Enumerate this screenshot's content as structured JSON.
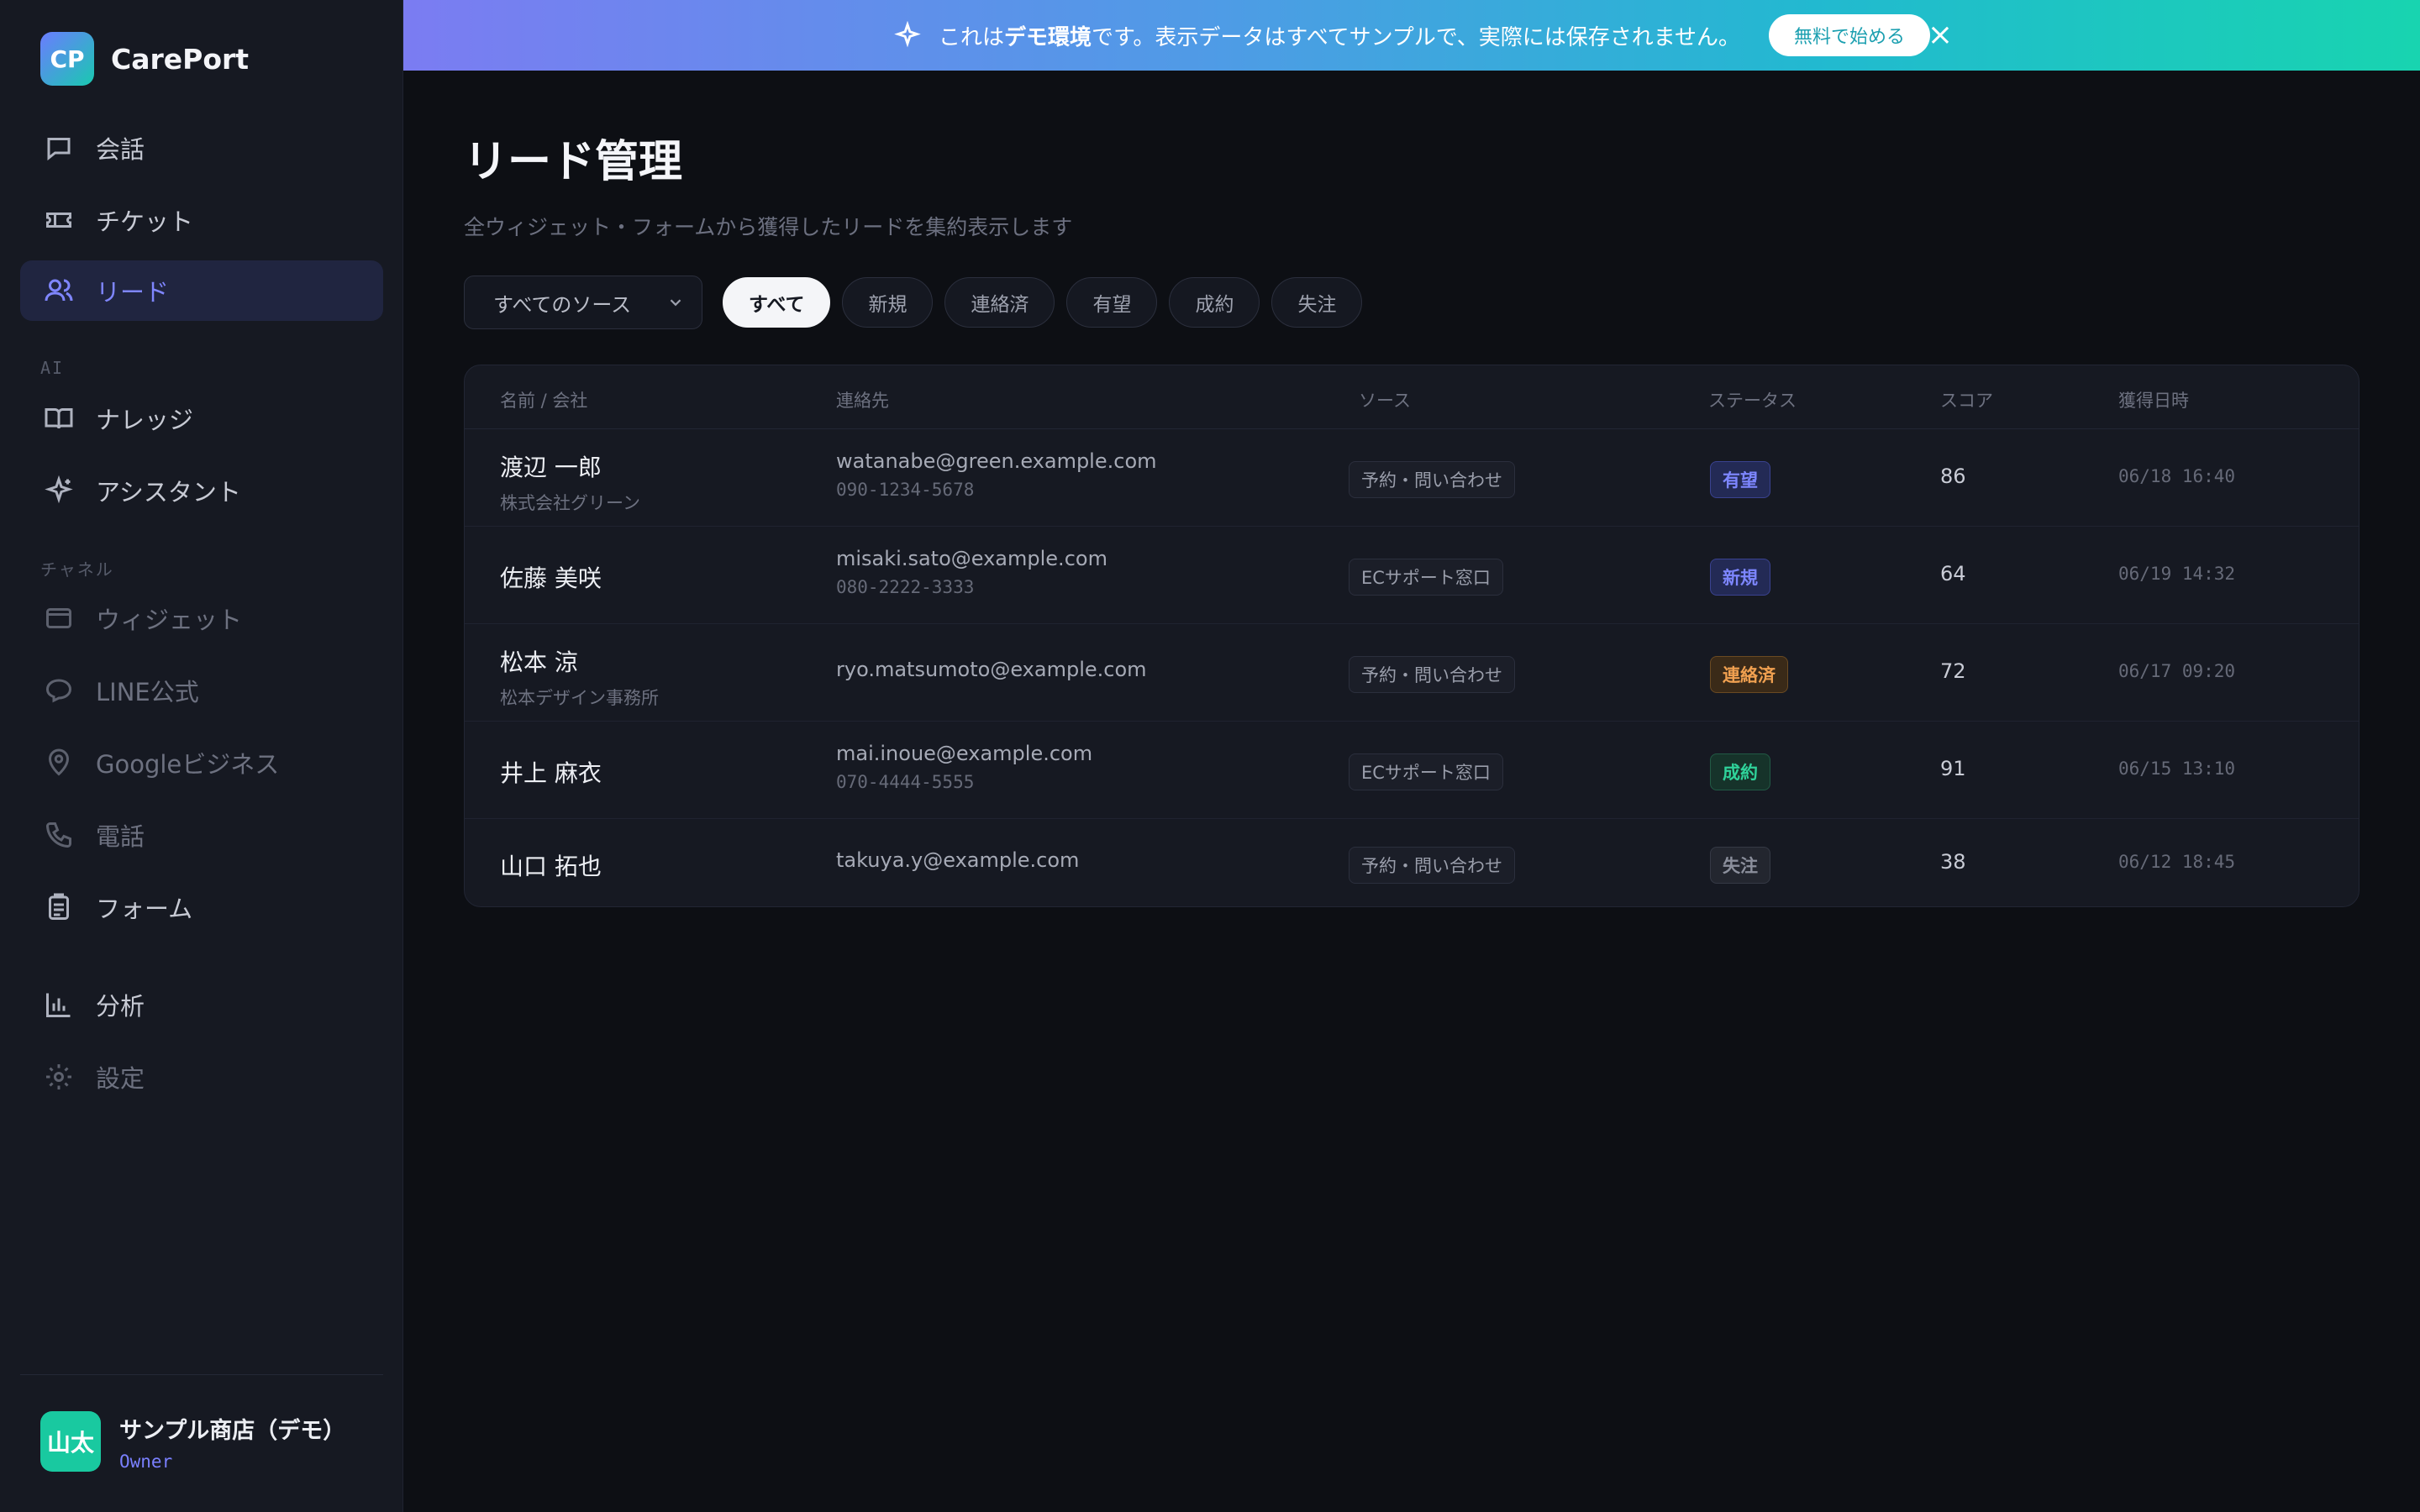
{
  "brand": {
    "logo": "CP",
    "name": "CarePort"
  },
  "nav": {
    "items": [
      {
        "label": "会話",
        "icon": "chat-icon",
        "state": "normal"
      },
      {
        "label": "チケット",
        "icon": "ticket-icon",
        "state": "normal"
      },
      {
        "label": "リード",
        "icon": "users-icon",
        "state": "active"
      }
    ],
    "section_ai": "AI",
    "ai_items": [
      {
        "label": "ナレッジ",
        "icon": "book-icon",
        "state": "normal"
      },
      {
        "label": "アシスタント",
        "icon": "sparkle-icon",
        "state": "normal"
      }
    ],
    "section_channel": "チャネル",
    "channel_items": [
      {
        "label": "ウィジェット",
        "icon": "widget-icon",
        "state": "dim"
      },
      {
        "label": "LINE公式",
        "icon": "line-icon",
        "state": "dim"
      },
      {
        "label": "Googleビジネス",
        "icon": "map-pin-icon",
        "state": "dim"
      },
      {
        "label": "電話",
        "icon": "phone-icon",
        "state": "dim"
      },
      {
        "label": "フォーム",
        "icon": "clipboard-icon",
        "state": "normal"
      }
    ],
    "bottom_items": [
      {
        "label": "分析",
        "icon": "chart-icon",
        "state": "normal"
      },
      {
        "label": "設定",
        "icon": "gear-icon",
        "state": "dim"
      }
    ]
  },
  "user": {
    "avatar": "山太",
    "name": "サンプル商店（デモ）",
    "role": "Owner"
  },
  "banner": {
    "prefix": "これは",
    "bold": "デモ環境",
    "suffix": "です。表示データはすべてサンプルで、実際には保存されません。",
    "cta": "無料で始める",
    "close": "×"
  },
  "page": {
    "title": "リード管理",
    "subtitle": "全ウィジェット・フォームから獲得したリードを集約表示します"
  },
  "filters": {
    "source_select": "すべてのソース",
    "chips": [
      "すべて",
      "新規",
      "連絡済",
      "有望",
      "成約",
      "失注"
    ],
    "active_chip": "すべて"
  },
  "table": {
    "headers": [
      "名前 / 会社",
      "連絡先",
      "ソース",
      "ステータス",
      "スコア",
      "獲得日時"
    ],
    "rows": [
      {
        "name": "渡辺 一郎",
        "company": "株式会社グリーン",
        "email": "watanabe@green.example.com",
        "phone": "090-1234-5678",
        "source": "予約・問い合わせ",
        "status": "有望",
        "score": "86",
        "date": "06/18 16:40"
      },
      {
        "name": "佐藤 美咲",
        "company": "",
        "email": "misaki.sato@example.com",
        "phone": "080-2222-3333",
        "source": "ECサポート窓口",
        "status": "新規",
        "score": "64",
        "date": "06/19 14:32"
      },
      {
        "name": "松本 涼",
        "company": "松本デザイン事務所",
        "email": "ryo.matsumoto@example.com",
        "phone": "",
        "source": "予約・問い合わせ",
        "status": "連絡済",
        "score": "72",
        "date": "06/17 09:20"
      },
      {
        "name": "井上 麻衣",
        "company": "",
        "email": "mai.inoue@example.com",
        "phone": "070-4444-5555",
        "source": "ECサポート窓口",
        "status": "成約",
        "score": "91",
        "date": "06/15 13:10"
      },
      {
        "name": "山口 拓也",
        "company": "",
        "email": "takuya.y@example.com",
        "phone": "",
        "source": "予約・問い合わせ",
        "status": "失注",
        "score": "38",
        "date": "06/12 18:45"
      }
    ]
  },
  "status_colors": {
    "有望": {
      "fg": "#7d86ff",
      "bg": "#232a55",
      "border": "#3a4290"
    },
    "新規": {
      "fg": "#7d86ff",
      "bg": "#232a55",
      "border": "#3a4290"
    },
    "連絡済": {
      "fg": "#f0a050",
      "bg": "#3a2a18",
      "border": "#6a4a22"
    },
    "成約": {
      "fg": "#2fd29a",
      "bg": "#16332a",
      "border": "#225a45"
    },
    "失注": {
      "fg": "#8b8f9c",
      "bg": "#23262f",
      "border": "#353945"
    }
  }
}
